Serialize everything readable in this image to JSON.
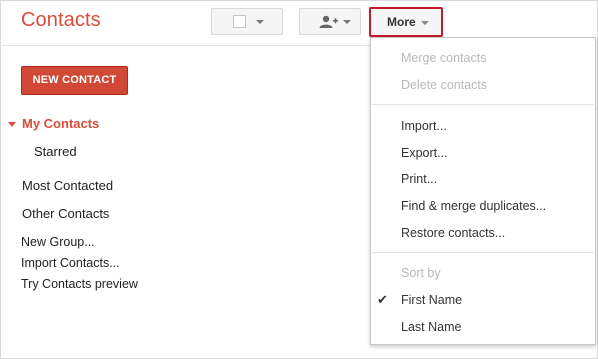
{
  "app": {
    "title": "Contacts"
  },
  "toolbar": {
    "more_label": "More"
  },
  "sidebar": {
    "new_contact_label": "NEW CONTACT",
    "my_contacts": "My Contacts",
    "starred": "Starred",
    "most_contacted": "Most Contacted",
    "other_contacts": "Other Contacts",
    "new_group": "New Group...",
    "import_contacts": "Import Contacts...",
    "try_preview": "Try Contacts preview"
  },
  "menu": {
    "merge": "Merge contacts",
    "delete": "Delete contacts",
    "import": "Import...",
    "export": "Export...",
    "print": "Print...",
    "find_merge": "Find & merge duplicates...",
    "restore": "Restore contacts...",
    "sort_by": "Sort by",
    "first_name": "First Name",
    "last_name": "Last Name",
    "check_mark": "✔"
  },
  "colors": {
    "accent": "#dd4b39",
    "highlight_border": "#c5192d"
  },
  "icons": [
    "caret-down-icon",
    "add-person-icon",
    "checkbox-icon",
    "checkmark-icon"
  ]
}
